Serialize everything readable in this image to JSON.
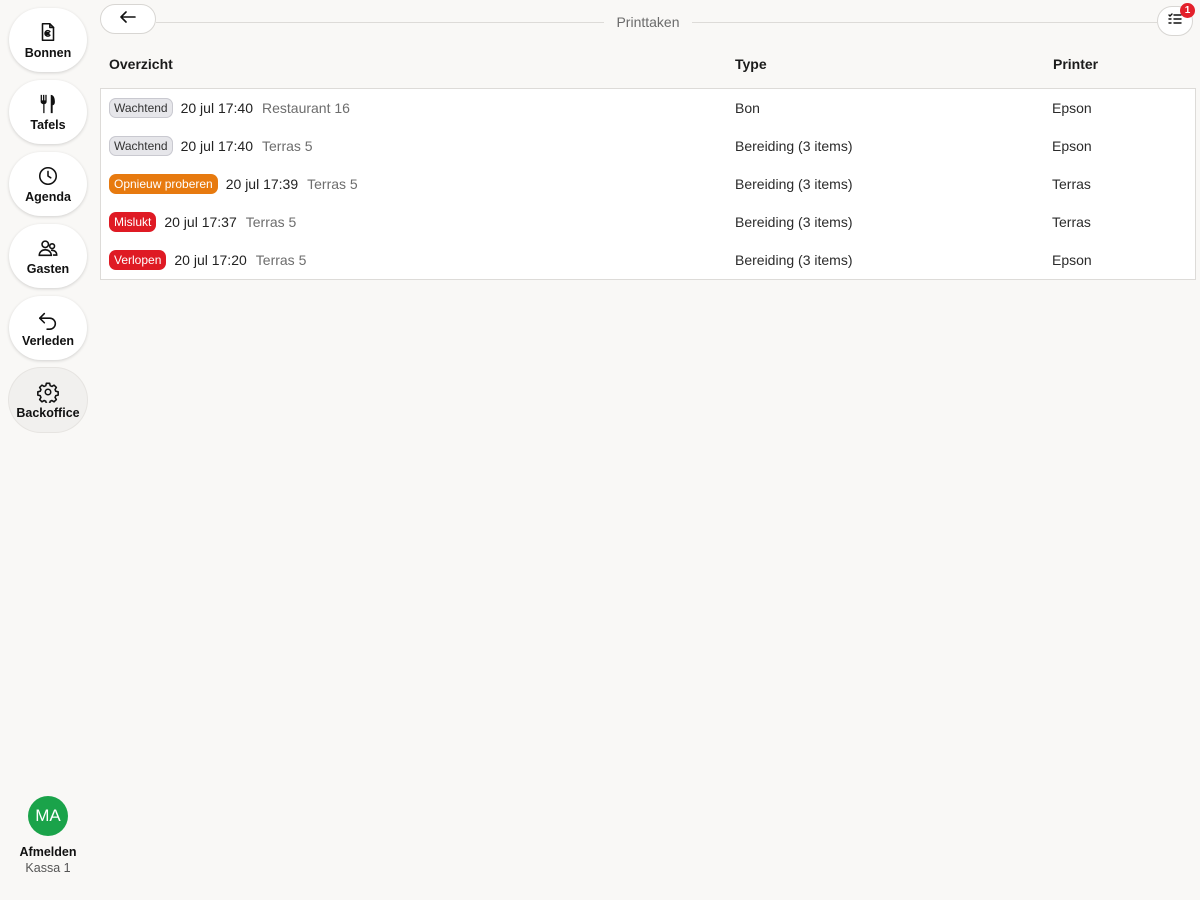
{
  "sidebar": {
    "items": [
      {
        "label": "Bonnen",
        "icon": "receipt-euro-icon"
      },
      {
        "label": "Tafels",
        "icon": "cutlery-icon"
      },
      {
        "label": "Agenda",
        "icon": "clock-icon"
      },
      {
        "label": "Gasten",
        "icon": "users-icon"
      },
      {
        "label": "Verleden",
        "icon": "undo-arrow-icon"
      },
      {
        "label": "Backoffice",
        "icon": "gear-icon"
      }
    ],
    "active_item": "Backoffice",
    "user": {
      "initials": "MA",
      "avatar_color": "#1aa34a",
      "logout_label": "Afmelden",
      "register": "Kassa 1"
    }
  },
  "header": {
    "title": "Printtaken",
    "back_icon": "arrow-left-icon",
    "list_icon": "list-check-icon",
    "notification_count": "1"
  },
  "table": {
    "columns": {
      "overview": "Overzicht",
      "type": "Type",
      "printer": "Printer"
    },
    "rows": [
      {
        "status": "Wachtend",
        "status_kind": "waiting",
        "datetime": "20 jul 17:40",
        "location": "Restaurant 16",
        "type": "Bon",
        "printer": "Epson"
      },
      {
        "status": "Wachtend",
        "status_kind": "waiting",
        "datetime": "20 jul 17:40",
        "location": "Terras 5",
        "type": "Bereiding (3 items)",
        "printer": "Epson"
      },
      {
        "status": "Opnieuw proberen",
        "status_kind": "retry",
        "datetime": "20 jul 17:39",
        "location": "Terras 5",
        "type": "Bereiding (3 items)",
        "printer": "Terras"
      },
      {
        "status": "Mislukt",
        "status_kind": "failed",
        "datetime": "20 jul 17:37",
        "location": "Terras 5",
        "type": "Bereiding (3 items)",
        "printer": "Terras"
      },
      {
        "status": "Verlopen",
        "status_kind": "failed",
        "datetime": "20 jul 17:20",
        "location": "Terras 5",
        "type": "Bereiding (3 items)",
        "printer": "Epson"
      }
    ]
  },
  "colors": {
    "waiting": "#e6e6ea",
    "retry": "#e77a0f",
    "failed": "#df1a24",
    "badge": "#e3202a"
  }
}
